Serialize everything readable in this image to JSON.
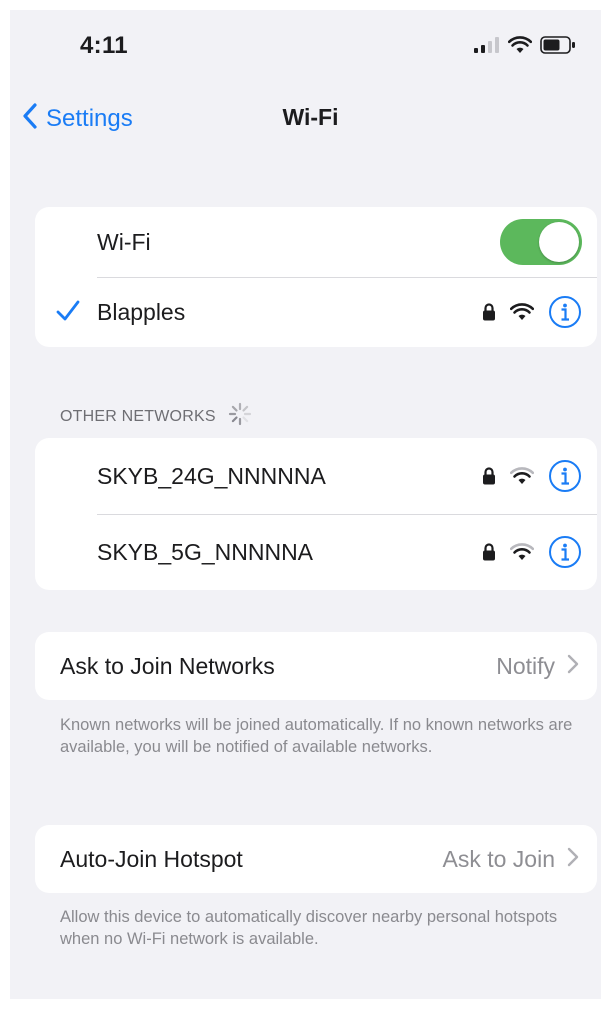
{
  "status_bar": {
    "time": "4:11",
    "icons": [
      "cellular-signal-icon",
      "wifi-icon",
      "battery-icon"
    ]
  },
  "nav": {
    "back_label": "Settings",
    "title": "Wi-Fi"
  },
  "wifi_card": {
    "toggle_label": "Wi-Fi",
    "toggle_on": true,
    "connected_network": "Blapples",
    "connected_icons": [
      "lock-icon",
      "wifi-icon",
      "info-icon"
    ]
  },
  "other_networks": {
    "header": "OTHER NETWORKS",
    "networks": [
      {
        "name": "SKYB_24G_NNNNNA",
        "icons": [
          "lock-icon",
          "wifi-icon",
          "info-icon"
        ]
      },
      {
        "name": "SKYB_5G_NNNNNA",
        "icons": [
          "lock-icon",
          "wifi-icon",
          "info-icon"
        ]
      }
    ]
  },
  "ask_to_join": {
    "label": "Ask to Join Networks",
    "value": "Notify",
    "footer": "Known networks will be joined automatically. If no known networks are available, you will be notified of available networks."
  },
  "auto_join_hotspot": {
    "label": "Auto-Join Hotspot",
    "value": "Ask to Join",
    "footer": "Allow this device to automatically discover nearby personal hotspots when no Wi-Fi network is available."
  },
  "colors": {
    "accent": "#1a7cf5",
    "toggle_on": "#5cb85c",
    "background": "#f2f2f6",
    "secondary_text": "#8e8e93"
  }
}
